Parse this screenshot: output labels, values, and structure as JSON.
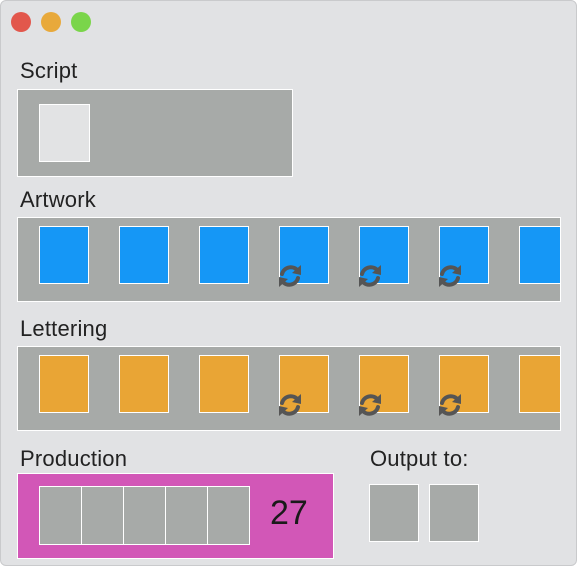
{
  "window": {
    "controls": [
      "close",
      "minimize",
      "zoom"
    ]
  },
  "sections": {
    "script": {
      "label": "Script",
      "cards": 1
    },
    "artwork": {
      "label": "Artwork",
      "color": "#1597f6",
      "cards": [
        {
          "syncing": false
        },
        {
          "syncing": false
        },
        {
          "syncing": false
        },
        {
          "syncing": true
        },
        {
          "syncing": true
        },
        {
          "syncing": true
        },
        {
          "syncing": false
        }
      ]
    },
    "lettering": {
      "label": "Lettering",
      "color": "#e9a535",
      "cards": [
        {
          "syncing": false
        },
        {
          "syncing": false
        },
        {
          "syncing": false
        },
        {
          "syncing": true
        },
        {
          "syncing": true
        },
        {
          "syncing": true
        },
        {
          "syncing": false
        }
      ]
    },
    "production": {
      "label": "Production",
      "color": "#d257b7",
      "slots": 5,
      "count": "27"
    },
    "output": {
      "label": "Output to:",
      "targets": 2
    }
  },
  "icons": {
    "sync": "sync-icon"
  }
}
